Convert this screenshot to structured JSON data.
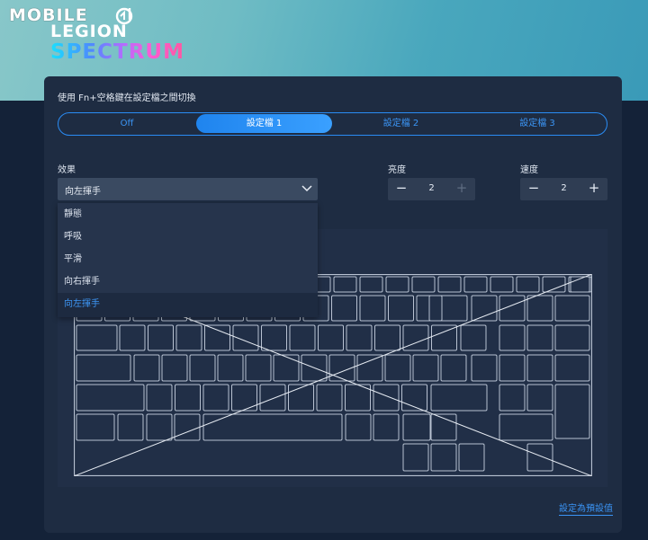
{
  "header": {
    "logo_mobile": "MOBILE",
    "logo_legion": "LEGION",
    "logo_spectrum": "SPECTRUM"
  },
  "panel": {
    "hint": "使用 Fn+空格鍵在設定檔之間切換",
    "profiles": [
      {
        "label": "Off",
        "active": false
      },
      {
        "label": "設定檔 1",
        "active": true
      },
      {
        "label": "設定檔 2",
        "active": false
      },
      {
        "label": "設定檔 3",
        "active": false
      }
    ],
    "effect": {
      "label": "效果",
      "value": "向左揮手",
      "options": [
        "靜態",
        "呼吸",
        "平滑",
        "向右揮手",
        "向左揮手"
      ],
      "selected_index": 4
    },
    "brightness": {
      "label": "亮度",
      "value": "2",
      "minus": "−",
      "plus": "+"
    },
    "speed": {
      "label": "速度",
      "value": "2",
      "minus": "−",
      "plus": "+"
    },
    "reset_label": "設定為預設值"
  },
  "colors": {
    "accent": "#2a8cf4",
    "panel_bg": "#1e2c42",
    "key_outline": "#b8c2d2"
  }
}
